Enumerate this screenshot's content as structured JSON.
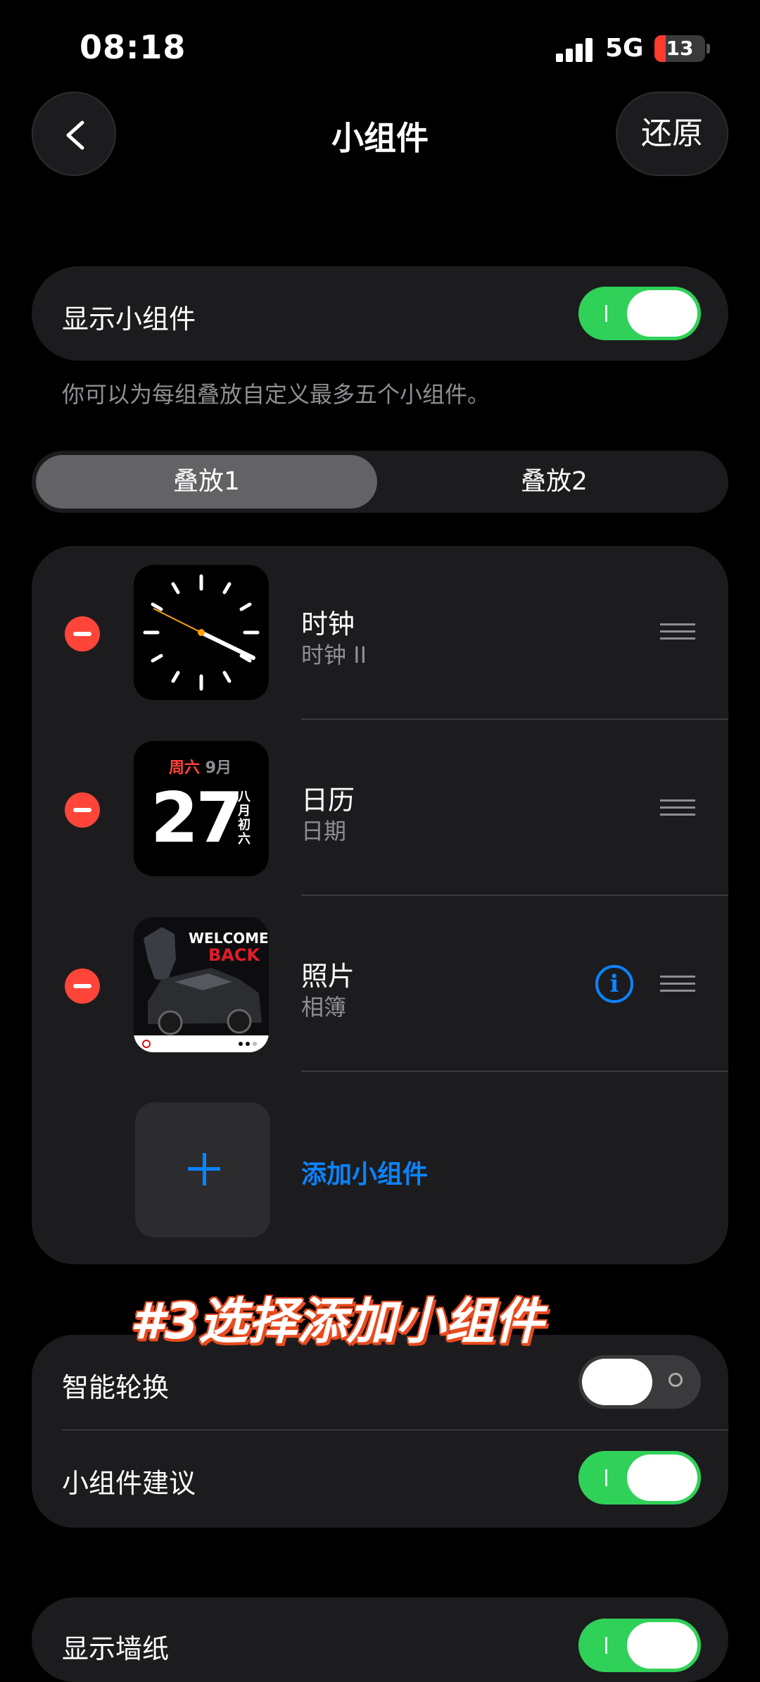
{
  "status": {
    "time": "08:18",
    "network": "5G",
    "battery": "13"
  },
  "header": {
    "title": "小组件",
    "restore_label": "还原"
  },
  "show_widgets": {
    "label": "显示小组件",
    "enabled": true
  },
  "hint": "你可以为每组叠放自定义最多五个小组件。",
  "segments": {
    "items": [
      "叠放1",
      "叠放2"
    ],
    "selected": "叠放1"
  },
  "widgets": [
    {
      "name": "时钟",
      "sub": "时钟 II",
      "icon": "clock-face"
    },
    {
      "name": "日历",
      "sub": "日期",
      "icon": "calendar-date",
      "preview": {
        "weekday": "周六",
        "month": "9月",
        "day": "27",
        "lunar": "八月初六"
      }
    },
    {
      "name": "照片",
      "sub": "相簿",
      "icon": "photo-album",
      "preview": {
        "line1": "WELCOME",
        "line2": "BACK"
      }
    }
  ],
  "add_widget": {
    "label": "添加小组件"
  },
  "overlay_caption": "#3选择添加小组件",
  "settings": [
    {
      "label": "智能轮换",
      "enabled": false
    },
    {
      "label": "小组件建议",
      "enabled": true
    }
  ],
  "partial_row": {
    "label": "显示墙纸",
    "enabled": true
  }
}
